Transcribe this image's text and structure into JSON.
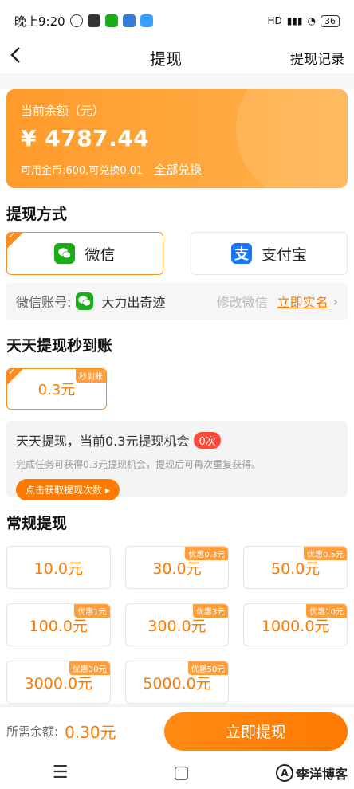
{
  "status": {
    "time": "晚上9:20",
    "network": "HD",
    "battery": "36"
  },
  "nav": {
    "title": "提现",
    "right": "提现记录"
  },
  "balance": {
    "label": "当前余额（元）",
    "amount": "¥ 4787.44",
    "sub": "可用金币:600,可兑换0.01",
    "exchange_link": "全部兑换"
  },
  "withdraw_method": {
    "title": "提现方式",
    "wechat": "微信",
    "alipay": "支付宝",
    "account_label": "微信账号:",
    "account_name": "大力出奇迹",
    "modify": "修改微信",
    "realname": "立即实名"
  },
  "daily": {
    "title": "天天提现秒到账",
    "amount": "0.3元",
    "tag": "秒到账",
    "info_line1": "天天提现，当前0.3元提现机会",
    "count_badge": "0次",
    "info_line2": "完成任务可获得0.3元提现机会，提现后可再次重复获得。",
    "button": "点击获取提现次数 ▸"
  },
  "regular": {
    "title": "常规提现",
    "options": [
      {
        "amount": "10.0元",
        "discount": ""
      },
      {
        "amount": "30.0元",
        "discount": "优惠0.3元"
      },
      {
        "amount": "50.0元",
        "discount": "优惠0.5元"
      },
      {
        "amount": "100.0元",
        "discount": "优惠1元"
      },
      {
        "amount": "300.0元",
        "discount": "优惠3元"
      },
      {
        "amount": "1000.0元",
        "discount": "优惠10元"
      },
      {
        "amount": "3000.0元",
        "discount": "优惠30元"
      },
      {
        "amount": "5000.0元",
        "discount": "优惠50元"
      }
    ]
  },
  "bottom": {
    "need_label": "所需余额:",
    "need_amount": "0.30元",
    "button": "立即提现"
  },
  "watermark": {
    "text": "李洋博客"
  },
  "colors": {
    "accent": "#ff7a00",
    "wechat": "#1aad19",
    "alipay": "#1677ff"
  }
}
